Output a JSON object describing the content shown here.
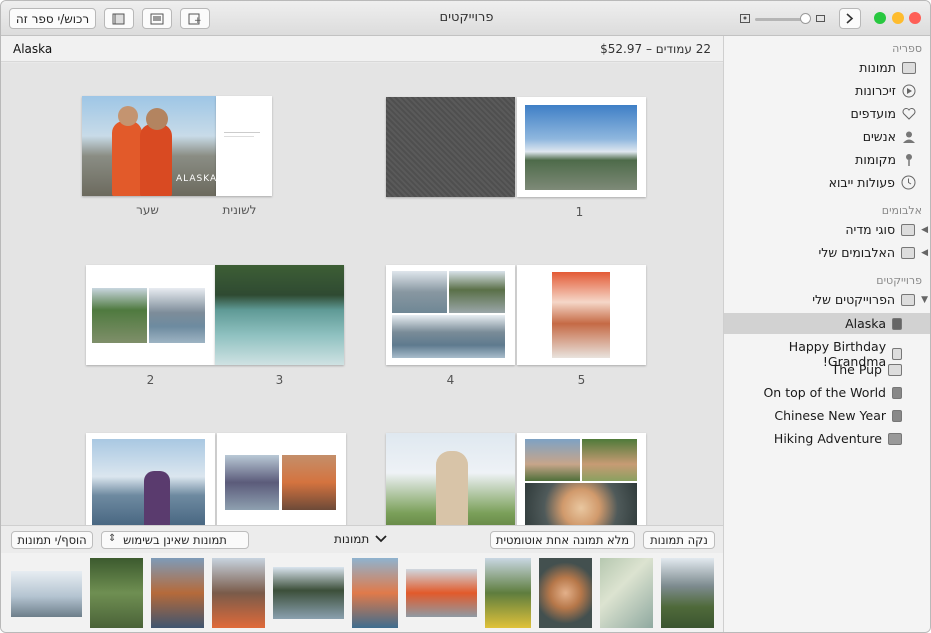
{
  "window": {
    "title": "פרוייקטים"
  },
  "toolbar": {
    "order_button": "רכוש/י ספר זה"
  },
  "colors": {
    "close": "#fe5f57",
    "minimize": "#febc2e",
    "zoom": "#28c840",
    "selection": "#d2d2d2"
  },
  "sidebar": {
    "library_header": "ספריה",
    "library_items": [
      {
        "label": "תמונות",
        "icon": "photos-icon"
      },
      {
        "label": "זיכרונות",
        "icon": "memories-icon"
      },
      {
        "label": "מועדפים",
        "icon": "heart-icon"
      },
      {
        "label": "אנשים",
        "icon": "person-icon"
      },
      {
        "label": "מקומות",
        "icon": "pin-icon"
      },
      {
        "label": "פעולות ייבוא",
        "icon": "clock-icon"
      }
    ],
    "albums_header": "אלבומים",
    "album_items": [
      {
        "label": "סוגי מדיה"
      },
      {
        "label": "האלבומים שלי"
      }
    ],
    "projects_header": "פרוייקטים",
    "projects_folder": "הפרוייקטים שלי",
    "projects": [
      {
        "label": "Alaska",
        "selected": true
      },
      {
        "label": "Happy Birthday Grandma!"
      },
      {
        "label": "The Pup"
      },
      {
        "label": "On top of the World"
      },
      {
        "label": "Chinese New Year"
      },
      {
        "label": "Hiking Adventure"
      }
    ]
  },
  "main": {
    "project_name": "Alaska",
    "summary": "22 עמודים – $52.97",
    "page_labels": {
      "cover": "שער",
      "flap": "לשונית",
      "p1": "1",
      "p2": "2",
      "p3": "3",
      "p4": "4",
      "p5": "5"
    },
    "cover_text": "ALASKA"
  },
  "strip": {
    "add_photos": "הוסף/י תמונות",
    "unused_filter": "תמונות שאינן בשימוש",
    "photos_menu": "תמונות",
    "autofill": "מלא תמונה אחת אוטומטית",
    "clear": "נקה תמונות"
  }
}
